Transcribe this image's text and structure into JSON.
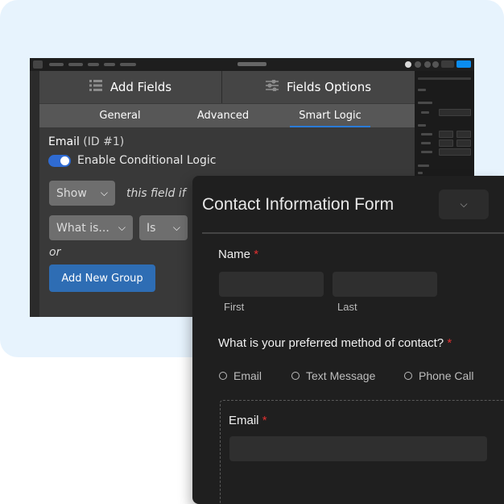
{
  "editor": {
    "top_tabs": {
      "add_fields": {
        "label": "Add Fields",
        "icon": "list-icon"
      },
      "field_options": {
        "label": "Fields Options",
        "icon": "sliders-icon"
      }
    },
    "sub_tabs": [
      {
        "label": "General",
        "active": false
      },
      {
        "label": "Advanced",
        "active": false
      },
      {
        "label": "Smart Logic",
        "active": true
      }
    ],
    "field_label": "Email",
    "field_id": "(ID #1)",
    "toggle_label": "Enable Conditional Logic",
    "toggle_on": true,
    "show_select": "Show",
    "this_field_if": "this field if",
    "condition_field_select": "What is...",
    "operator_select": "Is",
    "or_text": "or",
    "add_group_button": "Add New Group",
    "colors": {
      "accent": "#2e6db4",
      "toggle": "#2f6bd2",
      "publish": "#0b8df0"
    }
  },
  "form": {
    "title": "Contact Information Form",
    "name_field": {
      "label": "Name",
      "required": "*",
      "first_label": "First",
      "last_label": "Last"
    },
    "contact_question": {
      "label": "What is your preferred method of contact?",
      "required": "*",
      "options": [
        "Email",
        "Text Message",
        "Phone Call"
      ]
    },
    "email_field": {
      "label": "Email",
      "required": "*"
    },
    "colors": {
      "required": "#e23030",
      "background": "#1f1f1f"
    }
  }
}
